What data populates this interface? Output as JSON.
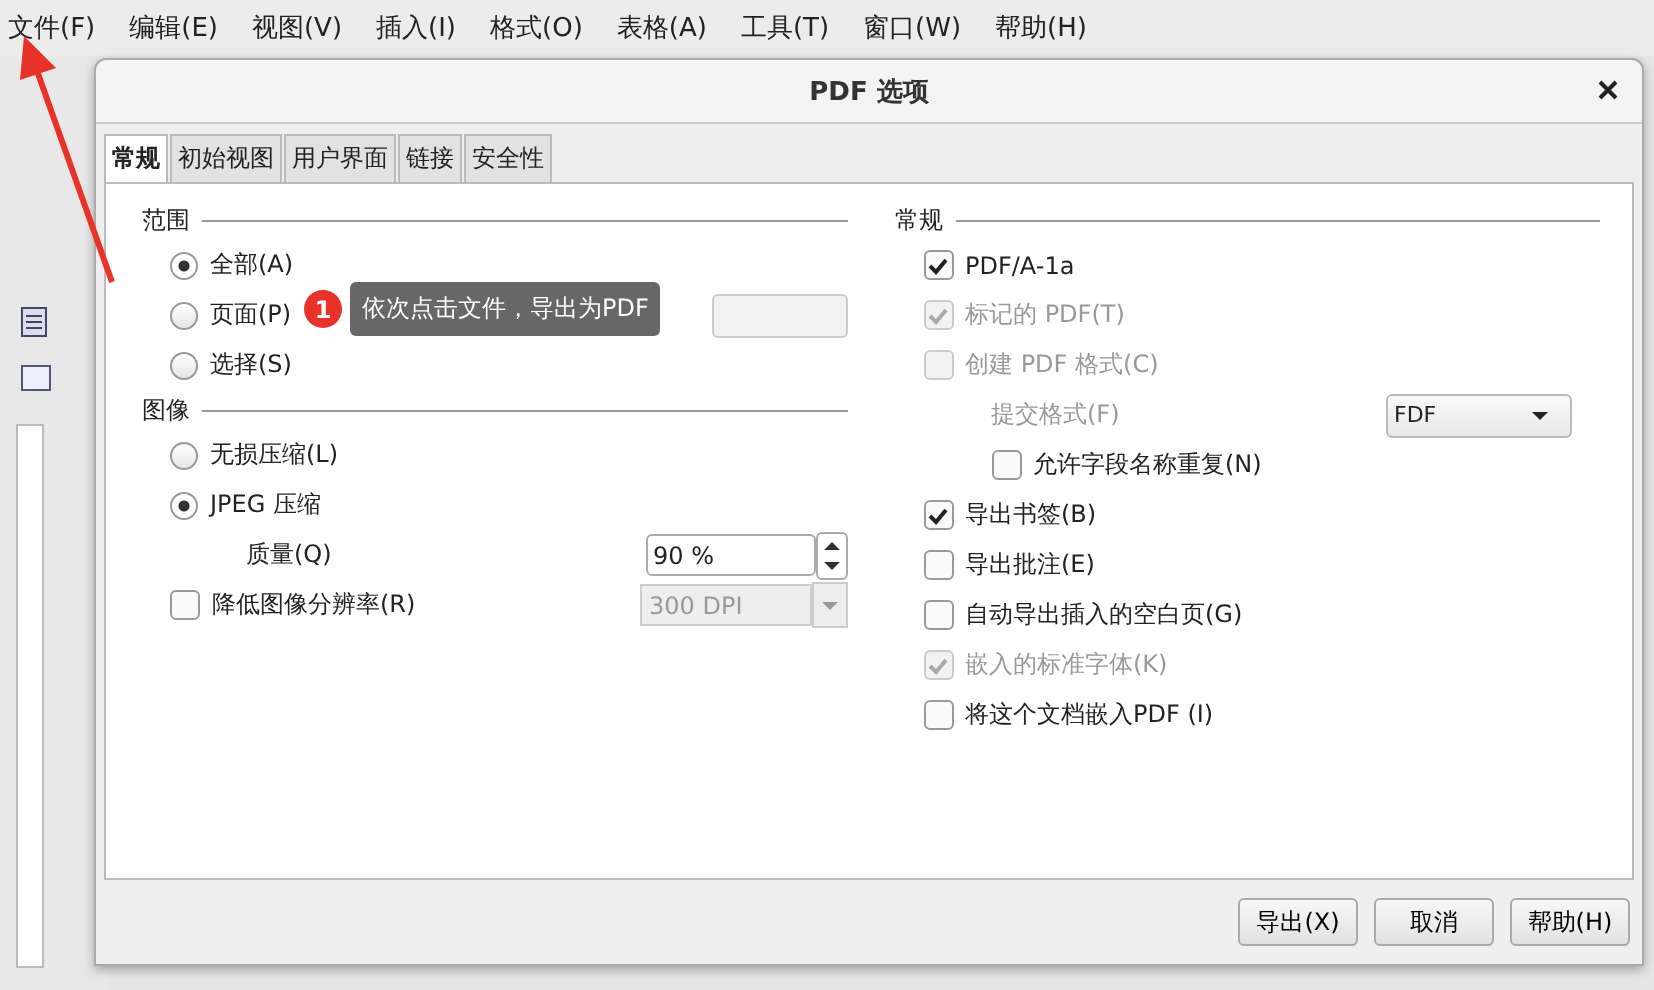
{
  "menu": [
    "文件(F)",
    "编辑(E)",
    "视图(V)",
    "插入(I)",
    "格式(O)",
    "表格(A)",
    "工具(T)",
    "窗口(W)",
    "帮助(H)"
  ],
  "dialog": {
    "title": "PDF 选项",
    "tabs": [
      {
        "label": "常规",
        "selected": true
      },
      {
        "label": "初始视图",
        "selected": false
      },
      {
        "label": "用户界面",
        "selected": false
      },
      {
        "label": "链接",
        "selected": false
      },
      {
        "label": "安全性",
        "selected": false
      }
    ],
    "range": {
      "title": "范围",
      "options": [
        {
          "label": "全部(A)",
          "selected": true
        },
        {
          "label": "页面(P)",
          "selected": false
        },
        {
          "label": "选择(S)",
          "selected": false
        }
      ]
    },
    "image": {
      "title": "图像",
      "options": [
        {
          "label": "无损压缩(L)",
          "selected": false
        },
        {
          "label": "JPEG 压缩",
          "selected": true
        }
      ],
      "quality": {
        "label": "质量(Q)",
        "value": "90 %"
      },
      "reduce": {
        "label": "降低图像分辨率(R)",
        "checked": false,
        "value": "300 DPI"
      }
    },
    "general": {
      "title": "常规",
      "items": [
        {
          "kind": "checkbox",
          "label": "PDF/A-1a",
          "checked": true,
          "disabled": false
        },
        {
          "kind": "checkbox",
          "label": "标记的 PDF(T)",
          "checked": true,
          "disabled": true
        },
        {
          "kind": "checkbox",
          "label": "创建 PDF 格式(C)",
          "checked": false,
          "disabled": true
        },
        {
          "kind": "select",
          "label": "提交格式(F)",
          "value": "FDF",
          "disabled": true
        },
        {
          "kind": "subcheckbox",
          "label": "允许字段名称重复(N)",
          "checked": false,
          "disabled": false
        },
        {
          "kind": "checkbox",
          "label": "导出书签(B)",
          "checked": true,
          "disabled": false
        },
        {
          "kind": "checkbox",
          "label": "导出批注(E)",
          "checked": false,
          "disabled": false
        },
        {
          "kind": "checkbox",
          "label": "自动导出插入的空白页(G)",
          "checked": false,
          "disabled": false
        },
        {
          "kind": "checkbox",
          "label": "嵌入的标准字体(K)",
          "checked": true,
          "disabled": true
        },
        {
          "kind": "checkbox",
          "label": "将这个文档嵌入PDF (I)",
          "checked": false,
          "disabled": false
        }
      ]
    },
    "buttons": [
      "导出(X)",
      "取消",
      "帮助(H)"
    ]
  },
  "annotation": {
    "number": "1",
    "text": "依次点击文件，导出为PDF"
  }
}
